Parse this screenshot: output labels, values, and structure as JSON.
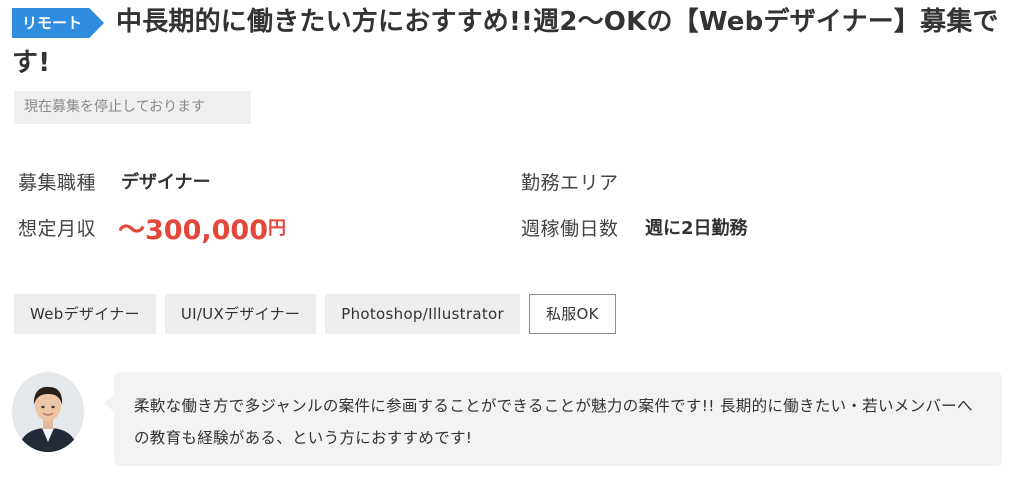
{
  "job": {
    "badge": "リモート",
    "title": "中長期的に働きたい方におすすめ!!週2〜OKの【Webデザイナー】募集です!",
    "status": "現在募集を停止しております"
  },
  "details": {
    "occupation_label": "募集職種",
    "occupation_value": "デザイナー",
    "area_label": "勤務エリア",
    "area_value": "",
    "salary_label": "想定月収",
    "salary_value": "〜300,000",
    "salary_unit": "円",
    "workdays_label": "週稼働日数",
    "workdays_value": "週に2日勤務"
  },
  "tags": [
    "Webデザイナー",
    "UI/UXデザイナー",
    "Photoshop/Illustrator",
    "私服OK"
  ],
  "comment": {
    "avatar_icon": "person-avatar-icon",
    "text": "柔軟な働き方で多ジャンルの案件に参画することができることが魅力の案件です!! 長期的に働きたい・若いメンバーへの教育も経験がある、という方におすすめです!"
  },
  "colors": {
    "badge": "#2f8de0",
    "salary": "#e5463a",
    "tag_bg": "#eeeeee",
    "comment_bg": "#f3f3f3"
  }
}
